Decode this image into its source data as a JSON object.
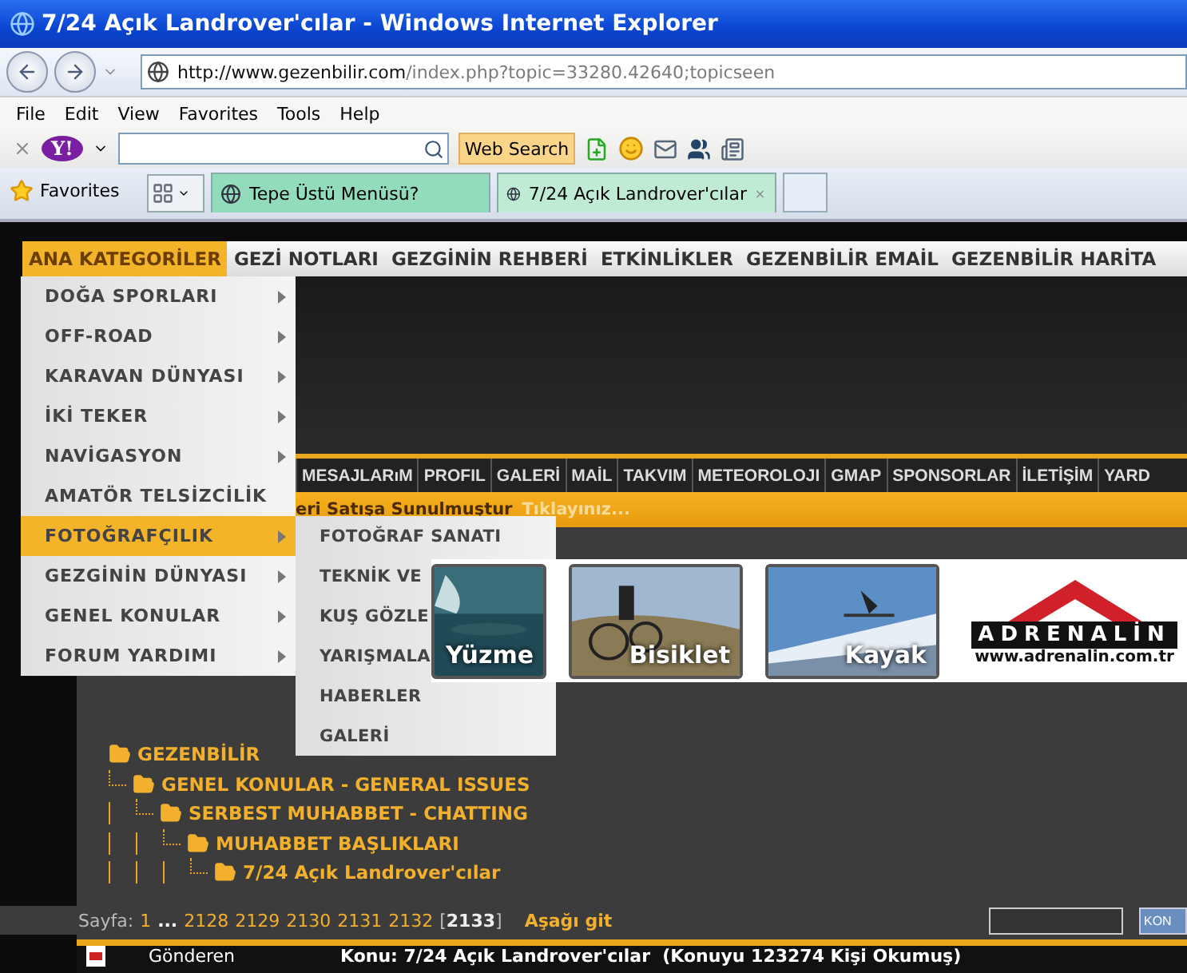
{
  "window": {
    "title": "7/24 Açık Landrover'cılar - Windows Internet Explorer"
  },
  "address": {
    "host": "http://www.gezenbilir.com",
    "path": "/index.php?topic=33280.42640;topicseen"
  },
  "menu_bar": [
    "File",
    "Edit",
    "View",
    "Favorites",
    "Tools",
    "Help"
  ],
  "search_toolbar": {
    "logo": "Y!",
    "button": "Web Search"
  },
  "favorites": {
    "label": "Favorites"
  },
  "tabs": [
    {
      "label": "Tepe Üstü Menüsü?",
      "selected": false
    },
    {
      "label": "7/24 Açık Landrover'cılar",
      "selected": true
    }
  ],
  "site_nav": [
    {
      "label": "ANA KATEGORİLER",
      "selected": true
    },
    {
      "label": "GEZİ NOTLARI",
      "selected": false
    },
    {
      "label": "GEZGİNİN REHBERİ",
      "selected": false
    },
    {
      "label": "ETKİNLİKLER",
      "selected": false
    },
    {
      "label": "GEZENBİLİR EMAİL",
      "selected": false
    },
    {
      "label": "GEZENBİLİR HARİTA",
      "selected": false
    }
  ],
  "category_menu": [
    {
      "label": "DOĞA SPORLARI",
      "has_submenu": true,
      "selected": false
    },
    {
      "label": "OFF-ROAD",
      "has_submenu": true,
      "selected": false
    },
    {
      "label": "KARAVAN DÜNYASI",
      "has_submenu": true,
      "selected": false
    },
    {
      "label": "İKİ TEKER",
      "has_submenu": true,
      "selected": false
    },
    {
      "label": "NAVİGASYON",
      "has_submenu": true,
      "selected": false
    },
    {
      "label": "AMATÖR TELSİZCİLİK",
      "has_submenu": false,
      "selected": false
    },
    {
      "label": "FOTOĞRAFÇILIK",
      "has_submenu": true,
      "selected": true
    },
    {
      "label": "GEZGİNİN DÜNYASI",
      "has_submenu": true,
      "selected": false
    },
    {
      "label": "GENEL KONULAR",
      "has_submenu": true,
      "selected": false
    },
    {
      "label": "FORUM YARDIMI",
      "has_submenu": true,
      "selected": false
    }
  ],
  "submenu": [
    "FOTOĞRAF SANATI",
    "TEKNİK VE",
    "KUŞ GÖZLE",
    "YARIŞMALA",
    "HABERLER",
    "GALERİ"
  ],
  "user_nav": [
    "MESAJLARıM",
    "PROFIL",
    "GALERİ",
    "MAİL",
    "TAKVIM",
    "METEOROLOJI",
    "GMAP",
    "SPONSORLAR",
    "İLETİŞİM",
    "YARD"
  ],
  "announcement": {
    "text": "eri Satışa Sunulmuştur",
    "link": "Tıklayınız..."
  },
  "banner": {
    "tiles": [
      {
        "caption": "Yüzme",
        "kind": "swim"
      },
      {
        "caption": "Bisiklet",
        "kind": "bike"
      },
      {
        "caption": "Kayak",
        "kind": "ski"
      }
    ],
    "logo": {
      "name": "ADRENALİN",
      "url": "www.adrenalin.com.tr"
    }
  },
  "breadcrumb": {
    "label": "GEZENBİLİR",
    "children": [
      {
        "label": "GENEL KONULAR - GENERAL ISSUES",
        "children": [
          {
            "label": "SERBEST MUHABBET - CHATTING",
            "children": [
              {
                "label": "MUHABBET BAŞLIKLARI",
                "children": [
                  {
                    "label": "7/24 Açık Landrover'cılar"
                  }
                ]
              }
            ]
          }
        ]
      }
    ]
  },
  "pager": {
    "label": "Sayfa:",
    "pages": [
      {
        "label": "1",
        "kind": "link"
      },
      {
        "label": "...",
        "kind": "ellipsis"
      },
      {
        "label": "2128",
        "kind": "link"
      },
      {
        "label": "2129",
        "kind": "link"
      },
      {
        "label": "2130",
        "kind": "link"
      },
      {
        "label": "2131",
        "kind": "link"
      },
      {
        "label": "2132",
        "kind": "link"
      },
      {
        "label": "[**2133**]",
        "kind": "current"
      }
    ],
    "jump": "Aşağı git",
    "button": "KON"
  },
  "post_header": {
    "author": "Gönderen",
    "subject": "Konu: 7/24 Açık Landrover'cılar  (Konuyu 123274 Kişi Okumuş)"
  }
}
